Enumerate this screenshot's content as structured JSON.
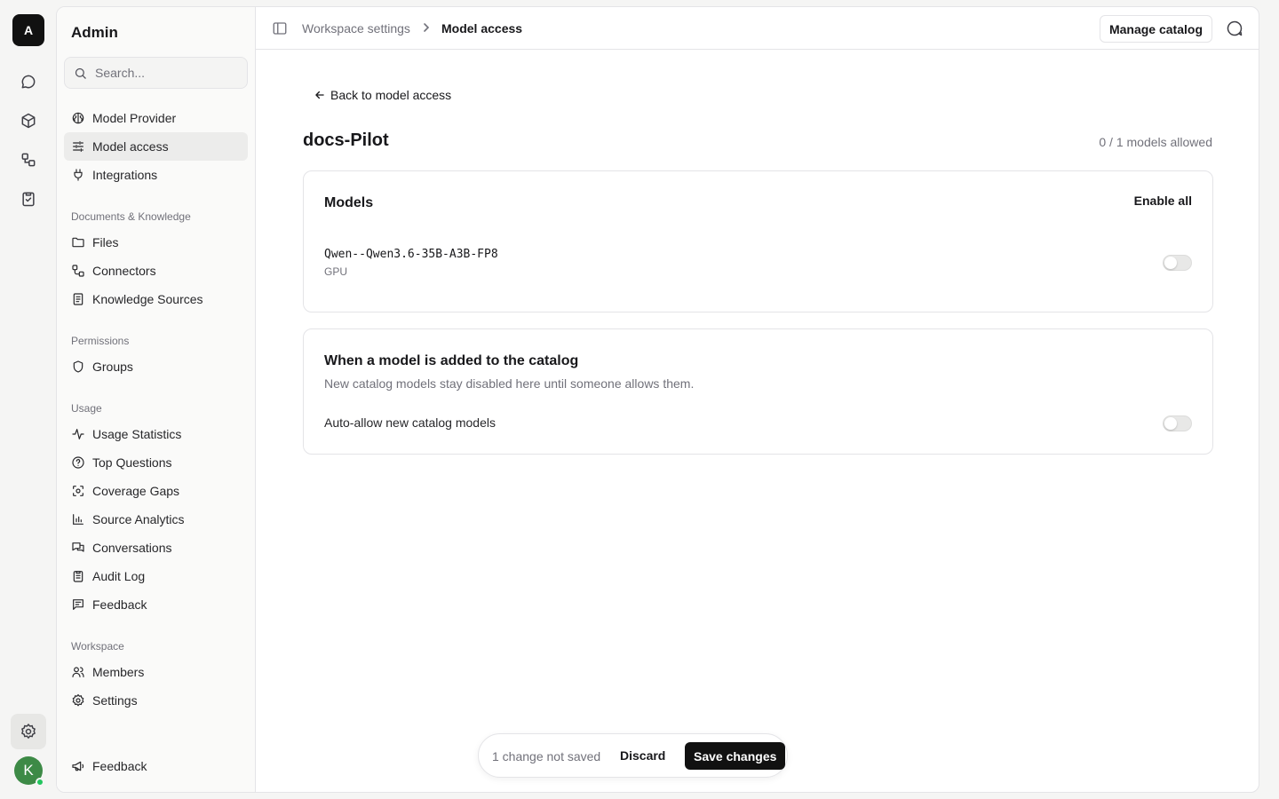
{
  "rail": {
    "logo": "A",
    "avatar": "K",
    "icons": [
      "chat-icon",
      "box-icon",
      "workflow-icon",
      "clipboard-check-icon",
      "gear-icon"
    ]
  },
  "sidebar": {
    "title": "Admin",
    "search_placeholder": "Search...",
    "top_items": [
      {
        "label": "Model Provider",
        "icon": "brain-icon"
      },
      {
        "label": "Model access",
        "icon": "sliders-icon",
        "active": true
      },
      {
        "label": "Integrations",
        "icon": "plug-icon"
      }
    ],
    "sections": [
      {
        "title": "Documents & Knowledge",
        "items": [
          {
            "label": "Files",
            "icon": "folder-icon"
          },
          {
            "label": "Connectors",
            "icon": "connector-icon"
          },
          {
            "label": "Knowledge Sources",
            "icon": "book-icon"
          }
        ]
      },
      {
        "title": "Permissions",
        "items": [
          {
            "label": "Groups",
            "icon": "shield-icon"
          }
        ]
      },
      {
        "title": "Usage",
        "items": [
          {
            "label": "Usage Statistics",
            "icon": "activity-icon"
          },
          {
            "label": "Top Questions",
            "icon": "help-circle-icon"
          },
          {
            "label": "Coverage Gaps",
            "icon": "scan-icon"
          },
          {
            "label": "Source Analytics",
            "icon": "bar-chart-icon"
          },
          {
            "label": "Conversations",
            "icon": "messages-icon"
          },
          {
            "label": "Audit Log",
            "icon": "clipboard-list-icon"
          },
          {
            "label": "Feedback",
            "icon": "message-square-icon"
          }
        ]
      },
      {
        "title": "Workspace",
        "items": [
          {
            "label": "Members",
            "icon": "users-icon"
          },
          {
            "label": "Settings",
            "icon": "settings-icon"
          }
        ]
      }
    ],
    "footer_item": {
      "label": "Feedback",
      "icon": "megaphone-icon"
    }
  },
  "topbar": {
    "breadcrumb": [
      "Workspace settings",
      "Model access"
    ],
    "manage_button": "Manage catalog"
  },
  "main": {
    "back_link": "Back to model access",
    "title": "docs-Pilot",
    "allowed_count": "0 / 1 models allowed",
    "models_card": {
      "heading": "Models",
      "enable_all": "Enable all",
      "models": [
        {
          "name": "Qwen--Qwen3.6-35B-A3B-FP8",
          "type": "GPU",
          "enabled": false
        }
      ]
    },
    "catalog_card": {
      "heading": "When a model is added to the catalog",
      "description": "New catalog models stay disabled here until someone allows them.",
      "toggle_label": "Auto-allow new catalog models",
      "enabled": false
    }
  },
  "savebar": {
    "status": "1 change not saved",
    "discard": "Discard",
    "save": "Save changes"
  }
}
